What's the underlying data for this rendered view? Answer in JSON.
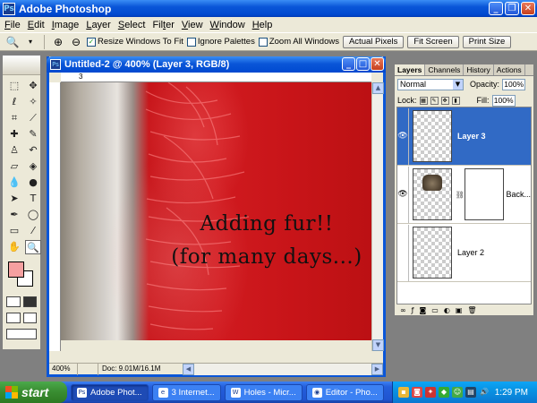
{
  "app": {
    "title": "Adobe Photoshop",
    "icon": "photoshop-app-icon"
  },
  "menu": [
    {
      "label": "File",
      "hot": "F"
    },
    {
      "label": "Edit",
      "hot": "E"
    },
    {
      "label": "Image",
      "hot": "I"
    },
    {
      "label": "Layer",
      "hot": "L"
    },
    {
      "label": "Select",
      "hot": "S"
    },
    {
      "label": "Filter",
      "hot": "t"
    },
    {
      "label": "View",
      "hot": "V"
    },
    {
      "label": "Window",
      "hot": "W"
    },
    {
      "label": "Help",
      "hot": "H"
    }
  ],
  "options": {
    "resize_windows": "Resize Windows To Fit",
    "resize_checked": true,
    "ignore_palettes": "Ignore Palettes",
    "zoom_all": "Zoom All Windows",
    "actual_pixels": "Actual Pixels",
    "fit_screen": "Fit Screen",
    "print_size": "Print Size"
  },
  "document": {
    "title": "Untitled-2 @ 400% (Layer 3, RGB/8)",
    "ruler_mark": "3",
    "text_line1": "Adding fur!!",
    "text_line2": "(for many days...)",
    "zoom": "400%",
    "doc_info": "Doc: 9.01M/16.1M"
  },
  "layers_panel": {
    "tabs": [
      "Layers",
      "Channels",
      "History",
      "Actions"
    ],
    "blend_mode": "Normal",
    "opacity_label": "Opacity:",
    "opacity": "100%",
    "lock_label": "Lock:",
    "fill_label": "Fill:",
    "fill": "100%",
    "layers": [
      {
        "name": "Layer 3",
        "visible": true,
        "selected": true
      },
      {
        "name": "Back...",
        "visible": true,
        "selected": false
      },
      {
        "name": "Layer 2",
        "visible": false,
        "selected": false
      }
    ]
  },
  "taskbar": {
    "start": "start",
    "tasks": [
      "Adobe Phot...",
      "3 Internet...",
      "Holes - Micr...",
      "Editor - Pho..."
    ],
    "clock": "1:29 PM"
  },
  "colors": {
    "canvas_red": "#c7151a",
    "foreground": "#f5a0a0",
    "xp_blue": "#0a56d8",
    "selection": "#316ac5"
  }
}
